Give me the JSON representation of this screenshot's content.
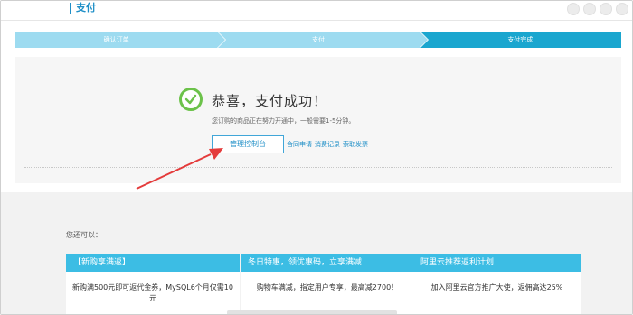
{
  "header": {
    "title": "支付"
  },
  "steps": [
    {
      "label": "确认订单"
    },
    {
      "label": "支付"
    },
    {
      "label": "支付完成"
    }
  ],
  "success": {
    "title": "恭喜，支付成功！",
    "subtitle": "您订购的商品正在努力开通中，一般需要1-5分钟。",
    "console_button": "管理控制台",
    "links": [
      "合同申请",
      "消费记录",
      "索取发票"
    ]
  },
  "also": {
    "label": "您还可以："
  },
  "cards": [
    {
      "header": "【新购享满返】",
      "body": "新购满500元即可返代金券，MySQL6个月仅需10元"
    },
    {
      "header": "冬日特惠，领优惠码，立享满减",
      "body": "购物车满减，指定用户专享，最高减2700！"
    },
    {
      "header": "阿里云推荐返利计划",
      "body": "加入阿里云官方推广大使，返佣高达25%"
    }
  ],
  "colors": {
    "accent": "#1aa6cf",
    "step_done": "#9ddbf0",
    "success_green": "#6cc24a",
    "arrow_red": "#e43b3b"
  }
}
